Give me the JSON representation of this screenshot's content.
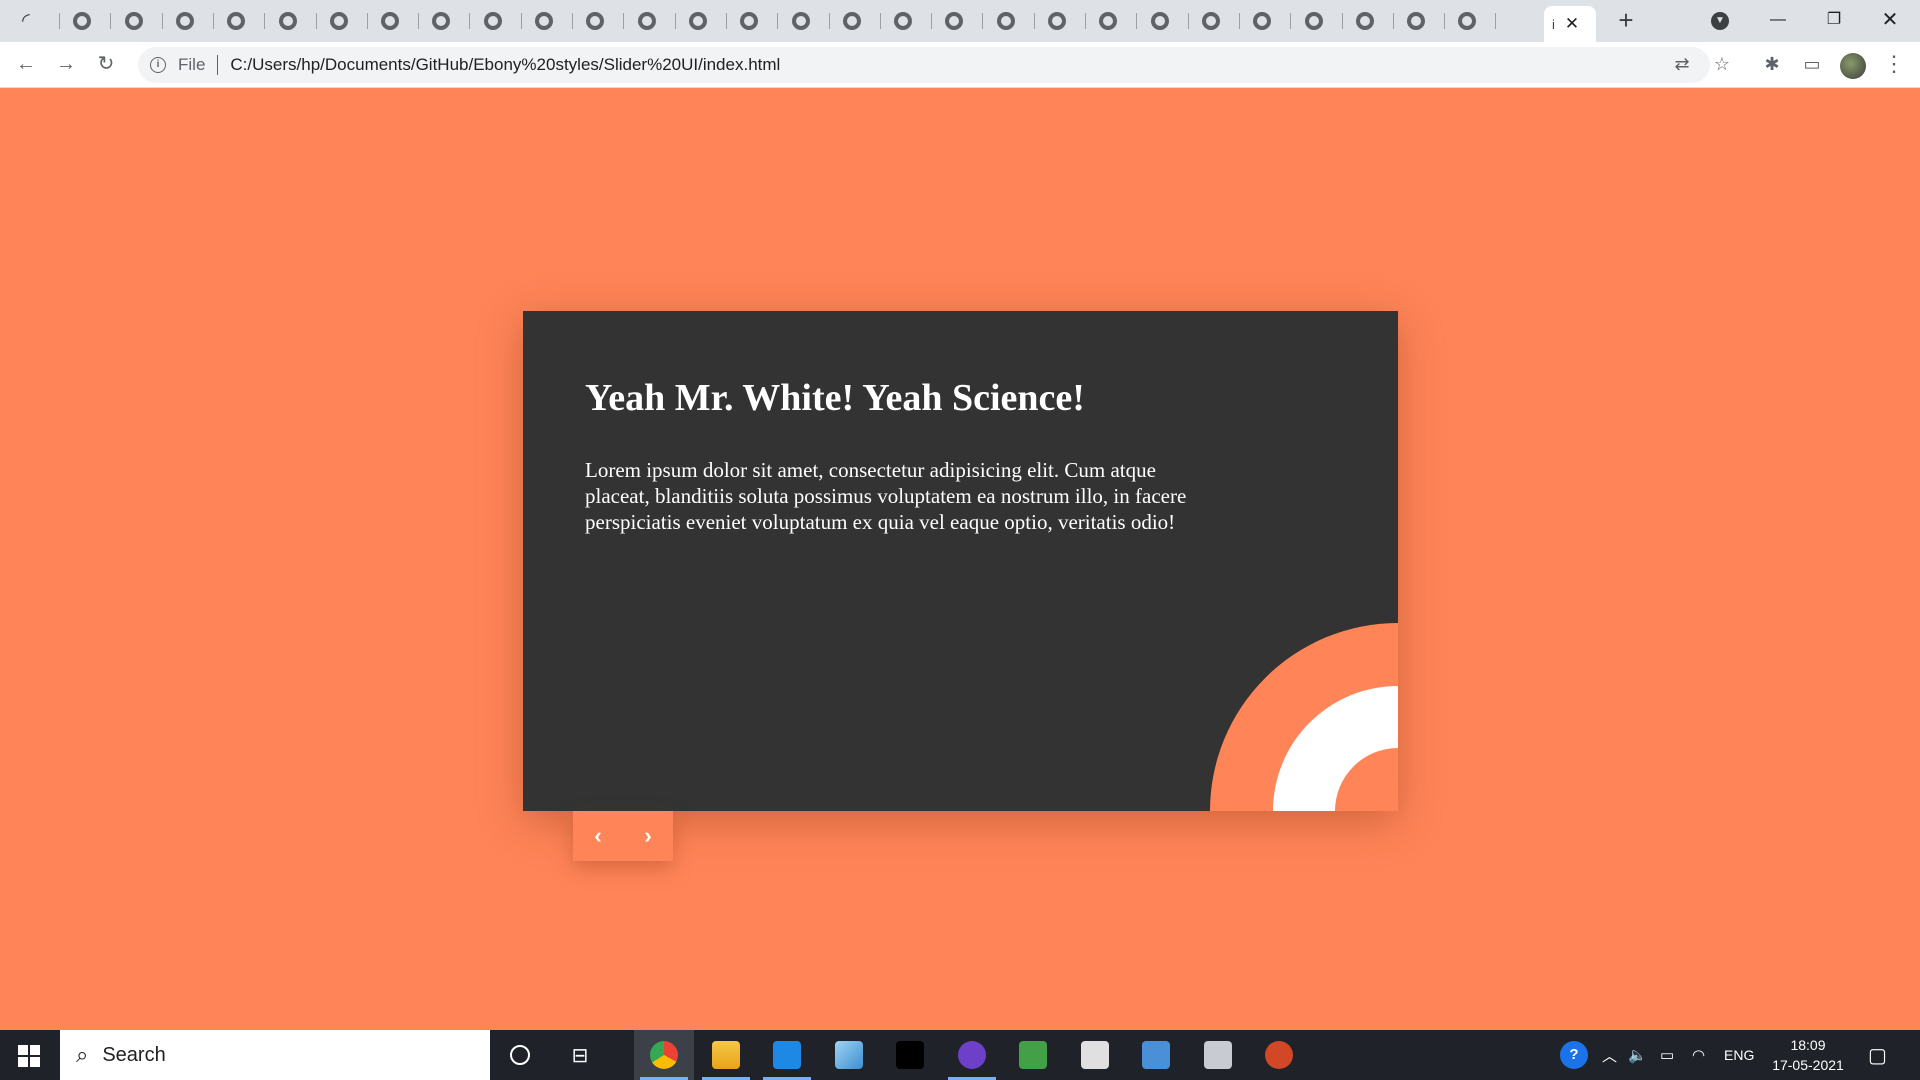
{
  "browser": {
    "tabs_count_visible": 29,
    "active_tab_title": "i",
    "new_tab_symbol": "+",
    "address": {
      "scheme_label": "File",
      "url": "C:/Users/hp/Documents/GitHub/Ebony%20styles/Slider%20UI/index.html"
    }
  },
  "page": {
    "background_color": "#ff8559",
    "card_color": "#333333",
    "slide": {
      "title": "Yeah Mr. White! Yeah Science!",
      "body": "Lorem ipsum dolor sit amet, consectetur adipisicing elit. Cum atque placeat, blanditiis soluta possimus voluptatem ea nostrum illo, in facere perspiciatis eveniet voluptatum ex quia vel eaque optio, veritatis odio!"
    },
    "nav": {
      "prev": "‹",
      "next": "›"
    }
  },
  "taskbar": {
    "search_placeholder": "Search",
    "tray": {
      "language": "ENG"
    },
    "clock": {
      "time": "18:09",
      "date": "17-05-2021"
    },
    "apps": [
      "chrome-icon",
      "file-explorer-icon",
      "vscode-icon",
      "notepad-icon",
      "terminal-icon",
      "github-desktop-icon",
      "nodejs-icon",
      "calculator-icon",
      "remote-desktop-icon",
      "photos-icon",
      "powerpoint-icon"
    ]
  }
}
